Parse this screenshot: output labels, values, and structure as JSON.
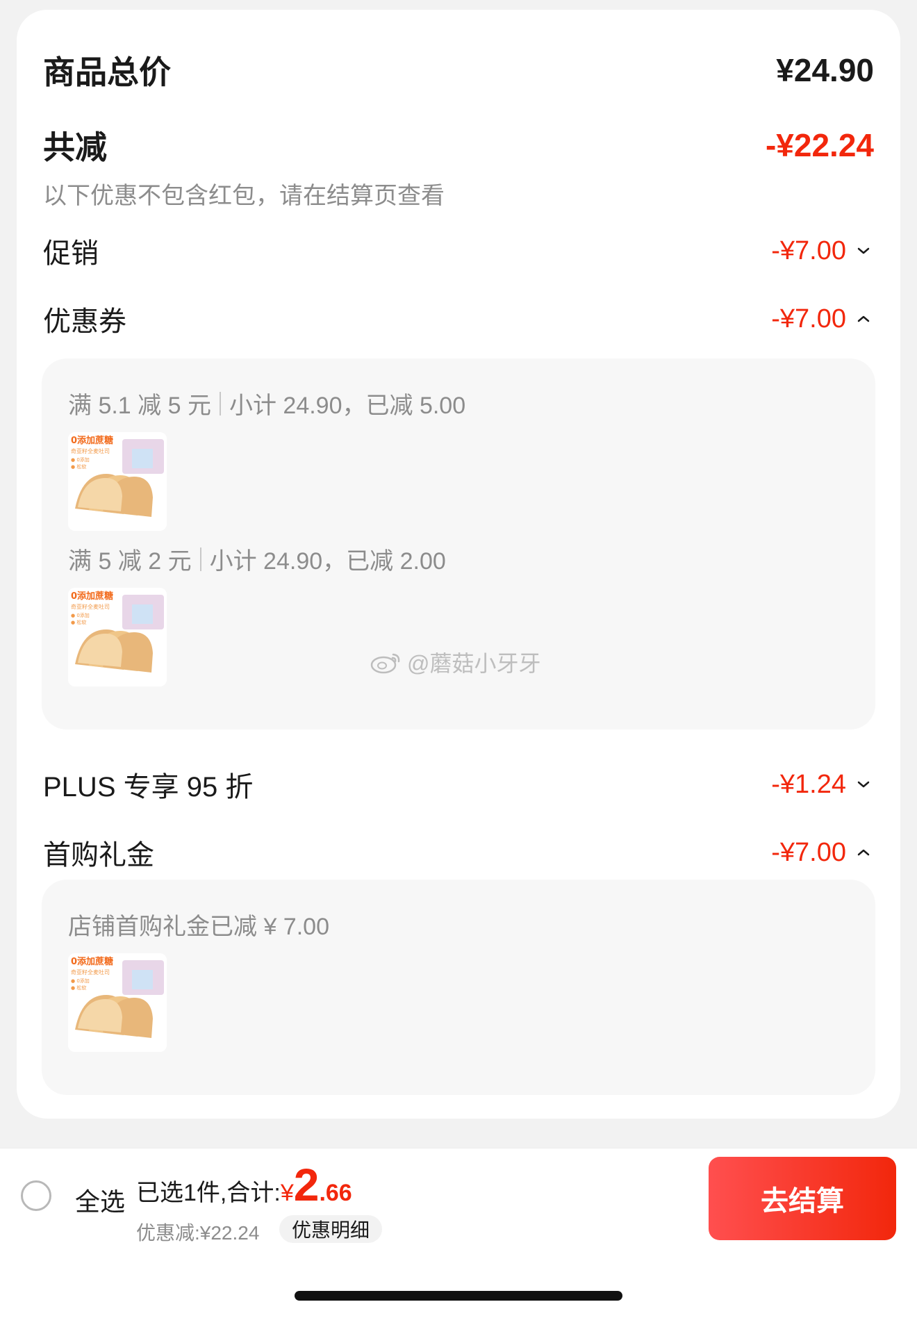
{
  "summary": {
    "goods_total_label": "商品总价",
    "goods_total_value": "¥24.90",
    "total_discount_label": "共减",
    "total_discount_value": "-¥22.24",
    "note": "以下优惠不包含红包，请在结算页查看"
  },
  "promotion": {
    "label": "促销",
    "value": "-¥7.00",
    "chevron": "chevron-down-icon"
  },
  "coupon": {
    "label": "优惠券",
    "value": "-¥7.00",
    "chevron": "chevron-up-icon",
    "items": [
      {
        "rule": "满 5.1 减 5 元",
        "detail": "小计 24.90，已减 5.00"
      },
      {
        "rule": "满 5 减 2 元",
        "detail": "小计 24.90，已减 2.00"
      }
    ]
  },
  "watermark": "@蘑菇小牙牙",
  "plus": {
    "label": "PLUS 专享 95 折",
    "value": "-¥1.24",
    "chevron": "chevron-down-icon"
  },
  "first_purchase": {
    "label": "首购礼金",
    "value": "-¥7.00",
    "chevron": "chevron-up-icon",
    "detail": "店铺首购礼金已减 ¥ 7.00"
  },
  "bottom_bar": {
    "select_all": "全选",
    "selected_prefix": "已选1件,合计:",
    "currency": "¥",
    "total_int": "2",
    "total_dec": ".66",
    "discount_line": "优惠减:¥22.24",
    "discount_detail_button": "优惠明细",
    "checkout_button": "去结算"
  },
  "colors": {
    "accent_red": "#f2270c",
    "panel_bg": "#f7f7f7",
    "page_bg": "#f2f2f2"
  }
}
